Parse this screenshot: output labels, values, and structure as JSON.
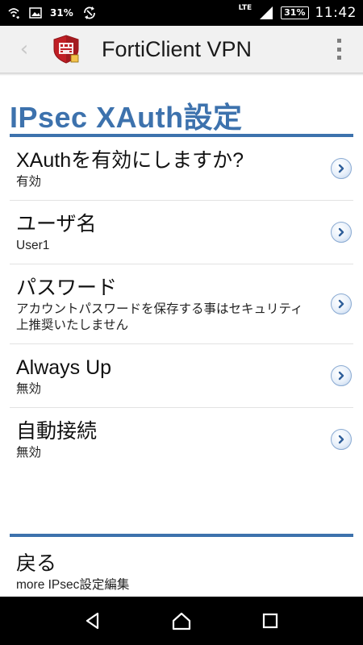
{
  "status_bar": {
    "notification_count": "31%",
    "network": "LTE",
    "battery": "31%",
    "time": "11:42"
  },
  "app_bar": {
    "title": "FortiClient VPN"
  },
  "section": {
    "title": "IPsec XAuth設定"
  },
  "settings": [
    {
      "title": "XAuthを有効にしますか?",
      "summary": "有効"
    },
    {
      "title": "ユーザ名",
      "summary": "User1"
    },
    {
      "title": "パスワード",
      "summary": "アカウントパスワードを保存する事はセキュリティ上推奨いたしません"
    },
    {
      "title": "Always Up",
      "summary": "無効"
    },
    {
      "title": "自動接続",
      "summary": "無効"
    }
  ],
  "footer": {
    "title": "戻る",
    "summary": "more IPsec設定編集"
  },
  "colors": {
    "accent": "#3d72ad",
    "app_bar_bg": "#f1f1f1",
    "system_bar_bg": "#000000"
  },
  "icons": {
    "status_left": [
      "wifi-calling-icon",
      "image-icon",
      "sync-icon"
    ],
    "status_right": [
      "signal-icon",
      "battery-icon"
    ],
    "app_bar": [
      "back-chevron-icon",
      "forticlient-logo-icon",
      "overflow-menu-icon"
    ],
    "row_action": "chevron-right-circle-icon",
    "nav": [
      "back-triangle-icon",
      "home-icon",
      "recents-square-icon"
    ]
  }
}
